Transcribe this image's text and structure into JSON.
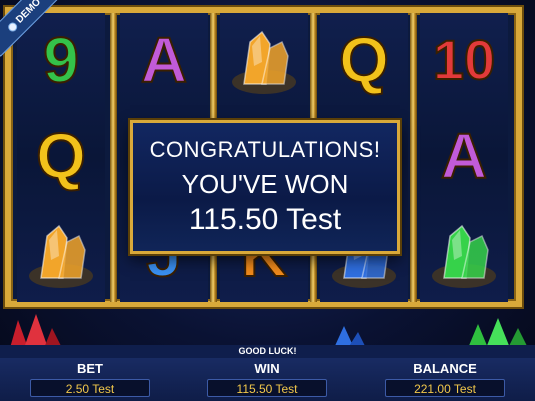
{
  "demo_badge": {
    "label": "DEMO",
    "icon": "info-icon"
  },
  "reels": [
    {
      "symbols": [
        {
          "kind": "text",
          "value": "9",
          "color": "#34c24a"
        },
        {
          "kind": "text",
          "value": "Q",
          "color": "#f2c21b"
        },
        {
          "kind": "gem",
          "name": "orange-crystal-icon",
          "color": "#f2a52a"
        }
      ]
    },
    {
      "symbols": [
        {
          "kind": "text",
          "value": "A",
          "color": "#c25bd8"
        },
        {
          "kind": "gem",
          "name": "blue-crystal-icon",
          "color": "#2f6fe0"
        },
        {
          "kind": "text",
          "value": "J",
          "color": "#3a8ff0"
        }
      ]
    },
    {
      "symbols": [
        {
          "kind": "gem",
          "name": "orange-crystal-icon",
          "color": "#f2a52a"
        },
        {
          "kind": "gem",
          "name": "orange-crystal-icon",
          "color": "#f2a52a"
        },
        {
          "kind": "text",
          "value": "K",
          "color": "#f08a1c"
        }
      ]
    },
    {
      "symbols": [
        {
          "kind": "text",
          "value": "Q",
          "color": "#f2c21b"
        },
        {
          "kind": "gem",
          "name": "blue-crystal-icon",
          "color": "#2f6fe0"
        },
        {
          "kind": "gem",
          "name": "blue-crystal-icon",
          "color": "#2f6fe0"
        }
      ]
    },
    {
      "symbols": [
        {
          "kind": "text",
          "value": "10",
          "color": "#e23a3a"
        },
        {
          "kind": "text",
          "value": "A",
          "color": "#c25bd8"
        },
        {
          "kind": "gem",
          "name": "green-crystal-icon",
          "color": "#36d24a"
        }
      ]
    }
  ],
  "win_message": {
    "line1": "CONGRATULATIONS!",
    "line2": "YOU'VE WON",
    "amount": "115.50 Test"
  },
  "status_bar": {
    "message": "GOOD LUCK!"
  },
  "stats": {
    "bet": {
      "label": "BET",
      "value": "2.50 Test"
    },
    "win": {
      "label": "WIN",
      "value": "115.50 Test"
    },
    "balance": {
      "label": "BALANCE",
      "value": "221.00 Test"
    }
  },
  "colors": {
    "frame_gold": "#d9a93a",
    "value_gold": "#f2c84b",
    "panel_blue": "#122761"
  }
}
